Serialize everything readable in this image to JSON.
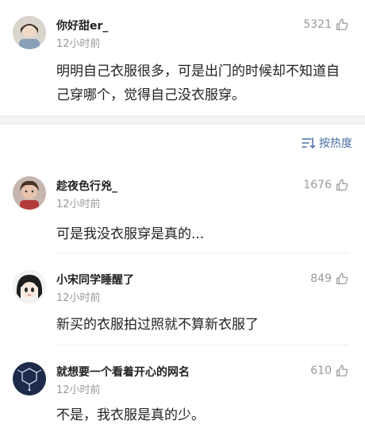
{
  "comments_top": [
    {
      "username": "你好甜er_",
      "time": "12小时前",
      "likes": "5321",
      "text": "明明自己衣服很多，可是出门的时候却不知道自己穿哪个，觉得自己没衣服穿。"
    }
  ],
  "sort": {
    "label": "按热度"
  },
  "comments": [
    {
      "username": "趁夜色行兇_",
      "time": "12小时前",
      "likes": "1676",
      "text": "可是我没衣服穿是真的..."
    },
    {
      "username": "小宋同学睡醒了",
      "time": "12小时前",
      "likes": "849",
      "text": "新买的衣服拍过照就不算新衣服了"
    },
    {
      "username": "就想要一个看着开心的网名",
      "time": "12小时前",
      "likes": "610",
      "text": "不是，我衣服是真的少。"
    }
  ],
  "icons": {
    "like": "thumbs-up-icon",
    "sort": "sort-lines-icon"
  },
  "colors": {
    "link": "#4a6fa5",
    "muted": "#9a9a9a",
    "text": "#222222",
    "band": "#f2f2f2"
  }
}
